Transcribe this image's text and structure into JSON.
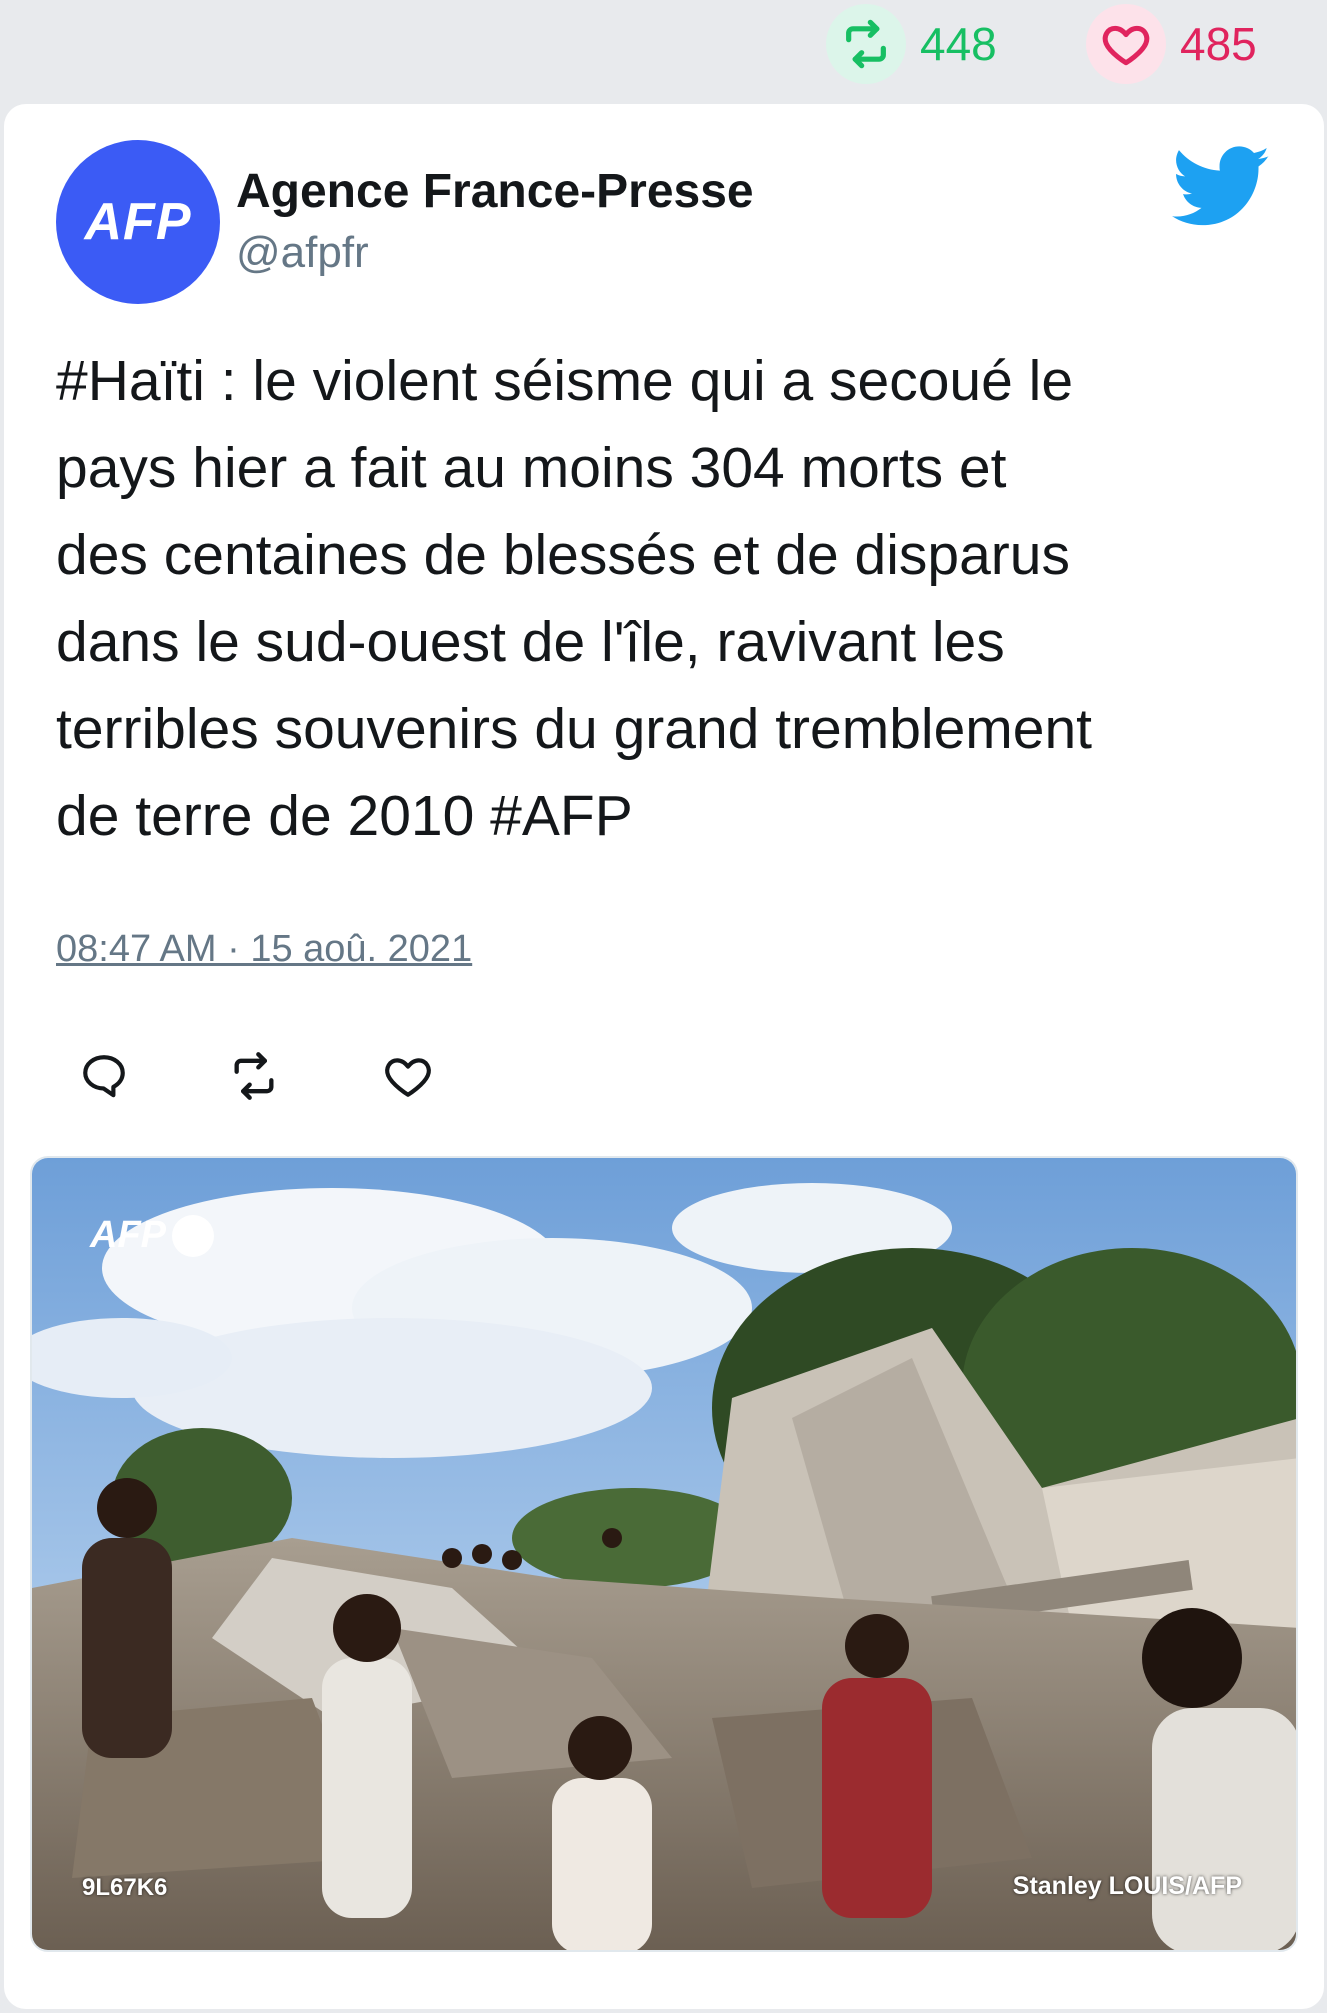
{
  "stats": {
    "retweet_icon": "retweet-icon",
    "retweet_count": "448",
    "like_icon": "heart-icon",
    "like_count": "485"
  },
  "tweet": {
    "avatar_text": "AFP",
    "author_name": "Agence France-Presse",
    "author_handle": "@afpfr",
    "platform_icon": "twitter-bird-icon",
    "text": "#Haïti : le violent séisme qui a secoué le\npays hier a fait au moins 304 morts et\ndes centaines de blessés et de disparus\ndans le sud-ouest de l'île, ravivant les\nterribles souvenirs du grand tremblement\nde terre de 2010 #AFP",
    "timestamp": "08:47 AM · 15 aoû. 2021",
    "actions": {
      "reply_icon": "reply-icon",
      "retweet_icon": "retweet-icon",
      "like_icon": "heart-icon"
    }
  },
  "photo": {
    "logo_text": "AFP",
    "code": "9L67K6",
    "credit": "Stanley LOUIS/AFP"
  },
  "colors": {
    "background": "#e8eaed",
    "retweet_green": "#17bf63",
    "like_red": "#e0245e",
    "twitter_blue": "#1da1f2",
    "afp_blue": "#3b5bf5",
    "secondary_text": "#657786"
  }
}
